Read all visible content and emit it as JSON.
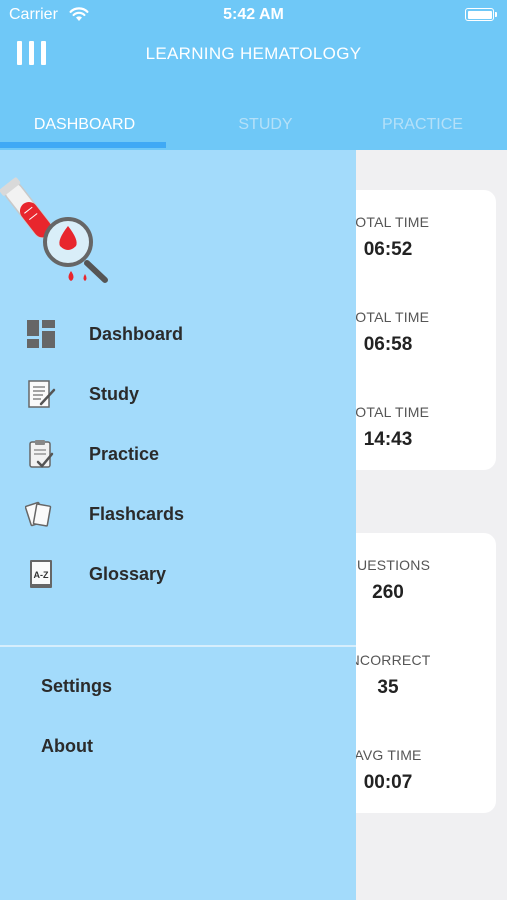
{
  "status_bar": {
    "carrier": "Carrier",
    "time": "5:42 AM"
  },
  "header": {
    "title": "LEARNING HEMATOLOGY"
  },
  "tabs": [
    {
      "label": "DASHBOARD"
    },
    {
      "label": "STUDY"
    },
    {
      "label": "PRACTICE"
    }
  ],
  "time_card": {
    "stats": [
      {
        "label": "TOTAL TIME",
        "value": "06:52"
      },
      {
        "label": "TOTAL TIME",
        "value": "06:58"
      },
      {
        "label": "TOTAL TIME",
        "value": "14:43"
      }
    ]
  },
  "questions_card": {
    "stats": [
      {
        "label": "QUESTIONS",
        "value": "260"
      },
      {
        "label": "INCORRECT",
        "value": "35"
      },
      {
        "label": "AVG TIME",
        "value": "00:07"
      }
    ]
  },
  "drawer": {
    "items": [
      {
        "label": "Dashboard",
        "icon": "dashboard-icon"
      },
      {
        "label": "Study",
        "icon": "study-icon"
      },
      {
        "label": "Practice",
        "icon": "practice-icon"
      },
      {
        "label": "Flashcards",
        "icon": "flashcards-icon"
      },
      {
        "label": "Glossary",
        "icon": "glossary-icon"
      }
    ],
    "settings_label": "Settings",
    "about_label": "About"
  },
  "colors": {
    "header": "#6fc8f7",
    "drawer": "#a3dbfb",
    "tab_indicator": "#3fa9f5",
    "blood_red": "#e8262d"
  }
}
